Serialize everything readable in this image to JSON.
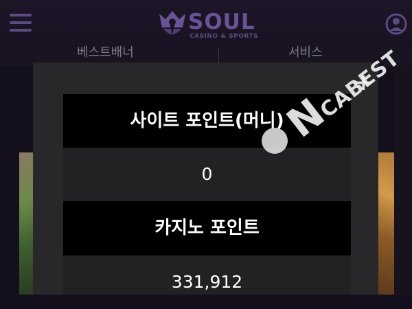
{
  "header": {
    "menu_icon": "hamburger-menu-icon",
    "logo_word": "SOUL",
    "logo_sub": "CASINO & SPORTS",
    "user_icon": "user-icon",
    "brand_color": "#6a5296"
  },
  "background": {
    "tab_left": "베스트배너",
    "tab_right": "서비스"
  },
  "points": {
    "site_title": "사이트 포인트(머니)",
    "site_value": "0",
    "casino_title": "카지노 포인트",
    "casino_value": "331,912"
  },
  "watermark": {
    "big_letter": "N",
    "small_text": "CABEST",
    "plus": "+"
  }
}
